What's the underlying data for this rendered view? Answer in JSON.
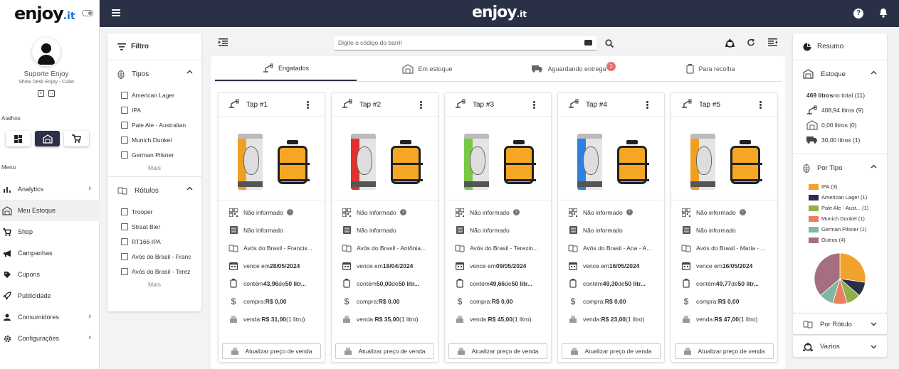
{
  "brand": {
    "logo_main": "enjoy",
    "logo_suffix": ".it"
  },
  "user": {
    "name": "Suporte Enjoy",
    "subtitle": "Show Desk Enjoy - Cubo"
  },
  "sidebar": {
    "shortcuts_label": "Atalhos",
    "menu_label": "Menu",
    "items": [
      {
        "label": "Analytics",
        "icon": "bar-chart-icon",
        "has_chevron": true
      },
      {
        "label": "Meu Estoque",
        "icon": "warehouse-icon",
        "active": true
      },
      {
        "label": "Shop",
        "icon": "cart-icon"
      },
      {
        "label": "Campanhas",
        "icon": "megaphone-icon"
      },
      {
        "label": "Cupons",
        "icon": "tag-icon"
      },
      {
        "label": "Publicidade",
        "icon": "rocket-icon"
      },
      {
        "label": "Consumidores",
        "icon": "person-icon",
        "has_chevron": true
      },
      {
        "label": "Configurações",
        "icon": "gear-icon",
        "has_chevron": true
      }
    ]
  },
  "filter": {
    "title": "Filtro",
    "types": {
      "title": "Tipos",
      "items": [
        "American Lager",
        "IPA",
        "Pale Ale - Australian",
        "Munich Dunkel",
        "German Pilsner"
      ],
      "more": "Mais"
    },
    "labels": {
      "title": "Rótulos",
      "items": [
        "Trooper",
        "Straat Bier",
        "RT166 IPA",
        "Avós do Brasil - Franc",
        "Avós do Brasil - Terez"
      ],
      "more": "Mais"
    }
  },
  "search": {
    "placeholder": "Digite o código do barril"
  },
  "tabs": [
    {
      "label": "Engatados",
      "active": true
    },
    {
      "label": "Em estoque"
    },
    {
      "label": "Aguardando entrega",
      "badge": "1"
    },
    {
      "label": "Para recolha"
    }
  ],
  "taps": [
    {
      "title": "Tap #1",
      "code": "Não informado",
      "serial": "Não informado",
      "label": "Avós do Brasil - Francis...",
      "expiry_prefix": "vence em ",
      "expiry": "28/05/2024",
      "contains_prefix": "contém ",
      "contains": "43,96",
      "contains_mid": " de ",
      "capacity": "50 litr...",
      "price_prefix": "compra: ",
      "price": "R$ 0,00",
      "sale_prefix": "venda: ",
      "sale": "R$ 31,00",
      "sale_suffix": " (1 litro)",
      "button": "Atualizar preço de venda",
      "band_color": "#f0a020"
    },
    {
      "title": "Tap #2",
      "code": "Não informado",
      "serial": "Não informado",
      "label": "Avós do Brasil - Antônia...",
      "expiry_prefix": "vence em ",
      "expiry": "18/04/2024",
      "contains_prefix": "contém ",
      "contains": "50,00",
      "contains_mid": " de ",
      "capacity": "50 litr...",
      "price_prefix": "compra: ",
      "price": "R$ 0,00",
      "sale_prefix": "venda: ",
      "sale": "R$ 35,00",
      "sale_suffix": " (1 litro)",
      "button": "Atualizar preço de venda",
      "band_color": "#e03030"
    },
    {
      "title": "Tap #3",
      "code": "Não informado",
      "serial": "Não informado",
      "label": "Avós do Brasil - Terezin...",
      "expiry_prefix": "vence em ",
      "expiry": "09/05/2024",
      "contains_prefix": "contém ",
      "contains": "49,66",
      "contains_mid": " de ",
      "capacity": "50 litr...",
      "price_prefix": "compra: ",
      "price": "R$ 0,00",
      "sale_prefix": "venda: ",
      "sale": "R$ 45,00",
      "sale_suffix": " (1 litro)",
      "button": "Atualizar preço de venda",
      "band_color": "#7ac943"
    },
    {
      "title": "Tap #4",
      "code": "Não informado",
      "serial": "Não informado",
      "label": "Avós do Brasil - Ana - A...",
      "expiry_prefix": "vence em ",
      "expiry": "16/05/2024",
      "contains_prefix": "contém ",
      "contains": "49,30",
      "contains_mid": " de ",
      "capacity": "50 litr...",
      "price_prefix": "compra: ",
      "price": "R$ 0,00",
      "sale_prefix": "venda: ",
      "sale": "R$ 23,00",
      "sale_suffix": " (1 litro)",
      "button": "Atualizar preço de venda",
      "band_color": "#2f7fe0"
    },
    {
      "title": "Tap #5",
      "code": "Não informado",
      "serial": "Não informado",
      "label": "Avós do Brasil - Maria - ...",
      "expiry_prefix": "vence em ",
      "expiry": "16/05/2024",
      "contains_prefix": "contém ",
      "contains": "49,77",
      "contains_mid": " de ",
      "capacity": "50 litr...",
      "price_prefix": "compra: ",
      "price": "R$ 0,00",
      "sale_prefix": "venda: ",
      "sale": "R$ 47,00",
      "sale_suffix": " (1 litro)",
      "button": "Atualizar preço de venda",
      "band_color": "#f0a020"
    }
  ],
  "summary": {
    "title": "Resumo",
    "stock": {
      "title": "Estoque",
      "total_strong": "469 litros",
      "total_rest": " no total (11)",
      "lines": [
        "408,94 litros (9)",
        "0,00 litros (0)",
        "30,00 litros (1)"
      ]
    },
    "by_type": {
      "title": "Por Tipo",
      "legend": [
        {
          "label": "IPA (3)",
          "color": "#f0a22c",
          "value": 3
        },
        {
          "label": "American Lager (1)",
          "color": "#2a3046",
          "value": 1
        },
        {
          "label": "Pale Ale - Aust... (1)",
          "color": "#8fb04b",
          "value": 1
        },
        {
          "label": "Munich Dunkel (1)",
          "color": "#ea7e62",
          "value": 1
        },
        {
          "label": "German Pilsner (1)",
          "color": "#7fb8a0",
          "value": 1
        },
        {
          "label": "Outros (4)",
          "color": "#a56f80",
          "value": 4
        }
      ]
    },
    "by_label": {
      "title": "Por Rótulo"
    },
    "empty": {
      "title": "Vazios"
    }
  }
}
